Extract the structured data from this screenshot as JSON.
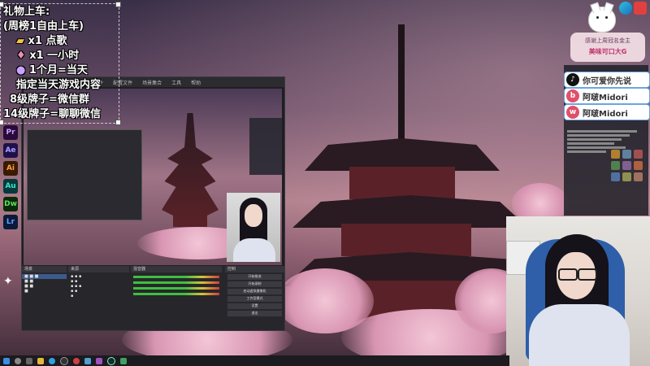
{
  "overlay": {
    "lines": [
      "礼物上车:",
      "(周榜1自由上车)",
      "x1 点歌",
      "x1 一小时",
      "1个月=当天",
      "指定当天游戏内容",
      "8级牌子=微信群",
      "14级牌子=聊聊微信"
    ]
  },
  "dock": {
    "icons": [
      {
        "name": "premiere-icon",
        "label": "Pr",
        "color": "#2a0a3a"
      },
      {
        "name": "after-effects-icon",
        "label": "Ae",
        "color": "#1f1049"
      },
      {
        "name": "illustrator-icon",
        "label": "Ai",
        "color": "#3a1a00"
      },
      {
        "name": "audition-icon",
        "label": "Au",
        "color": "#063a3a"
      },
      {
        "name": "dreamweaver-icon",
        "label": "Dw",
        "color": "#0a2a0a"
      },
      {
        "name": "lightroom-icon",
        "label": "Lr",
        "color": "#0a1a3a"
      }
    ]
  },
  "banner": {
    "line1": "感谢上周冠名金主",
    "line2": "美味可口大G"
  },
  "social": [
    {
      "icon": "douyin-icon",
      "label": "你可爱你先说",
      "glyph": "♪",
      "color": "#111"
    },
    {
      "icon": "bilibili-icon",
      "label": "阿啵Midori",
      "glyph": "b",
      "color": "#e0506a"
    },
    {
      "icon": "weibo-icon",
      "label": "阿啵Midori",
      "glyph": "w",
      "color": "#e0506a"
    }
  ],
  "obs": {
    "menu": [
      "文件",
      "编辑",
      "视图",
      "停靠部件",
      "配置文件",
      "场景集合",
      "工具",
      "帮助"
    ],
    "scenes_header": "场景",
    "sources_header": "来源",
    "mixer_header": "混音器",
    "controls_header": "控制",
    "buttons": [
      "开始推流",
      "开始录制",
      "启动虚拟摄像机",
      "工作室模式",
      "设置",
      "退出"
    ]
  },
  "colors": {
    "accent": "#6aa6e0",
    "pagoda": "#5a2228"
  }
}
